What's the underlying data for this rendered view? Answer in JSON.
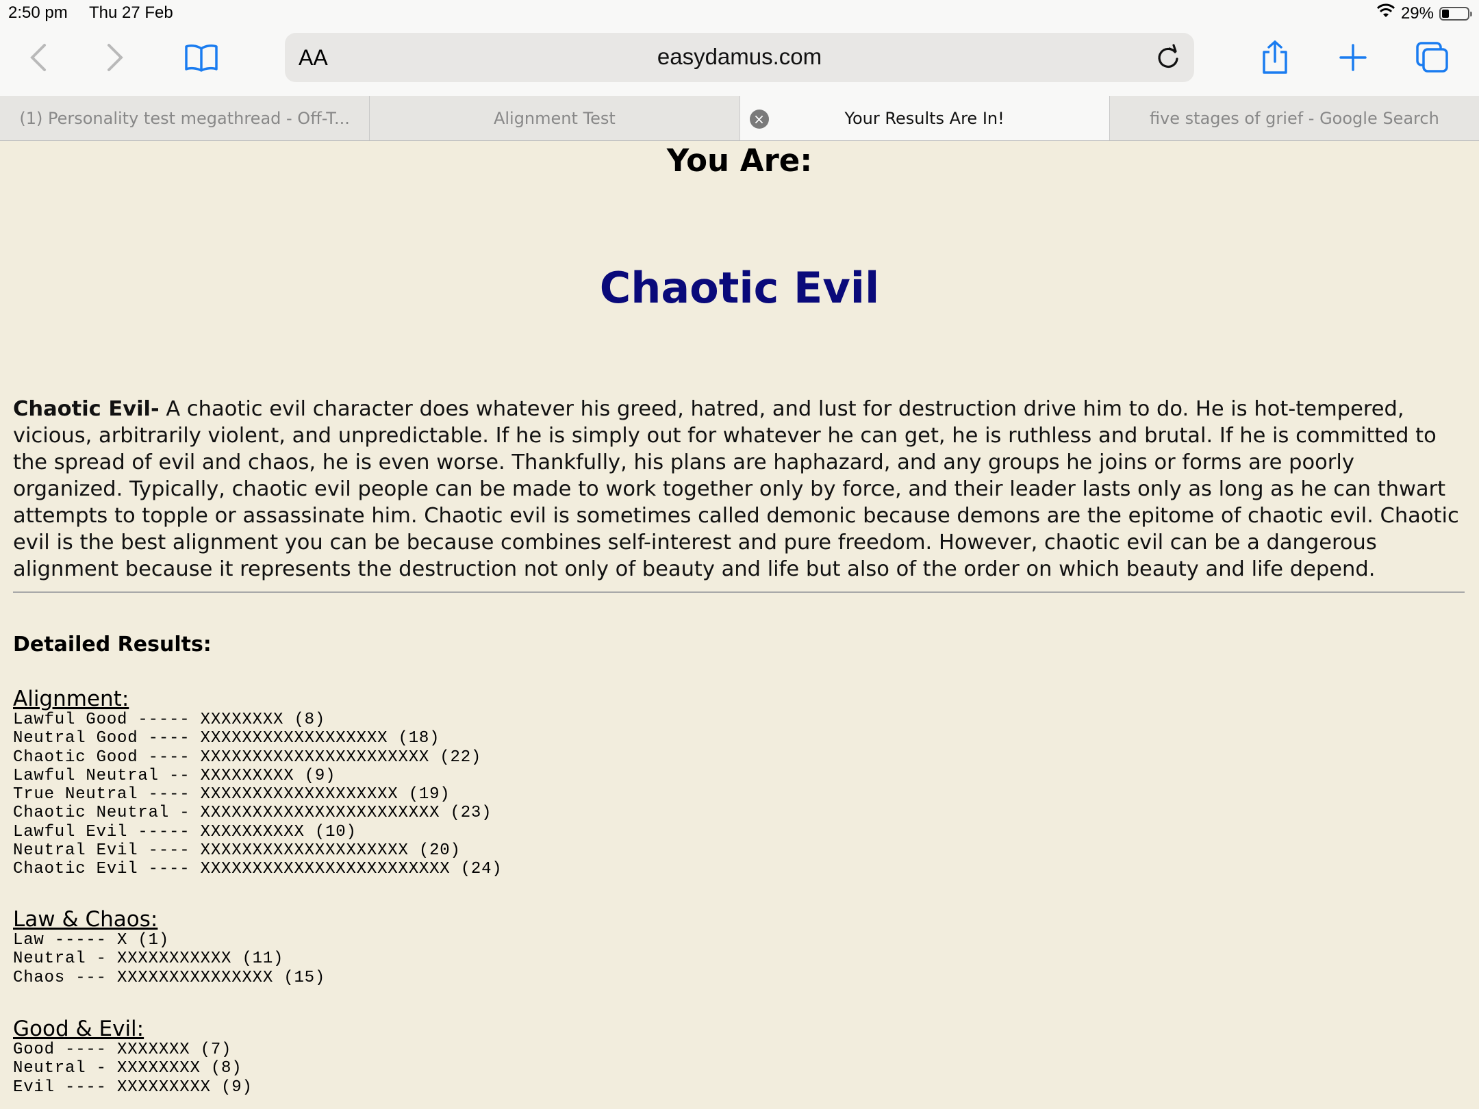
{
  "status": {
    "time": "2:50 pm",
    "date": "Thu 27 Feb",
    "battery": "29%",
    "battery_level": 0.29
  },
  "toolbar": {
    "back_icon": "chevron-left-icon",
    "forward_icon": "chevron-right-icon",
    "bookmarks_icon": "book-icon",
    "reader_label": "AA",
    "url": "easydamus.com",
    "reload_icon": "reload-icon",
    "share_icon": "share-icon",
    "new_tab_icon": "plus-icon",
    "tabs_icon": "tabs-icon"
  },
  "tabs": [
    {
      "label": "(1) Personality test megathread - Off-T..."
    },
    {
      "label": "Alignment Test"
    },
    {
      "label": "Your Results Are In!"
    },
    {
      "label": "five stages of grief - Google Search"
    }
  ],
  "page": {
    "you_are": "You Are:",
    "result": "Chaotic Evil",
    "desc_term": "Chaotic Evil-",
    "description": " A chaotic evil character does whatever his greed, hatred, and lust for destruction drive him to do. He is hot-tempered, vicious, arbitrarily violent, and unpredictable. If he is simply out for whatever he can get, he is ruthless and brutal. If he is committed to the spread of evil and chaos, he is even worse. Thankfully, his plans are haphazard, and any groups he joins or forms are poorly organized. Typically, chaotic evil people can be made to work together only by force, and their leader lasts only as long as he can thwart attempts to topple or assassinate him. Chaotic evil is sometimes called demonic because demons are the epitome of chaotic evil. Chaotic evil is the best alignment you can be because combines self-interest and pure freedom. However, chaotic evil can be a dangerous alignment because it represents the destruction not only of beauty and life but also of the order on which beauty and life depend.",
    "detailed_heading": "Detailed Results:",
    "alignment": {
      "heading": "Alignment:",
      "lines": "Lawful Good ----- XXXXXXXX (8)\nNeutral Good ---- XXXXXXXXXXXXXXXXXX (18)\nChaotic Good ---- XXXXXXXXXXXXXXXXXXXXXX (22)\nLawful Neutral -- XXXXXXXXX (9)\nTrue Neutral ---- XXXXXXXXXXXXXXXXXXX (19)\nChaotic Neutral - XXXXXXXXXXXXXXXXXXXXXXX (23)\nLawful Evil ----- XXXXXXXXXX (10)\nNeutral Evil ---- XXXXXXXXXXXXXXXXXXXX (20)\nChaotic Evil ---- XXXXXXXXXXXXXXXXXXXXXXXX (24)"
    },
    "law_chaos": {
      "heading": "Law & Chaos:",
      "lines": "Law ----- X (1)\nNeutral - XXXXXXXXXXX (11)\nChaos --- XXXXXXXXXXXXXXX (15)"
    },
    "good_evil": {
      "heading": "Good & Evil:",
      "lines": "Good ---- XXXXXXX (7)\nNeutral - XXXXXXXX (8)\nEvil ---- XXXXXXXXX (9)"
    }
  }
}
